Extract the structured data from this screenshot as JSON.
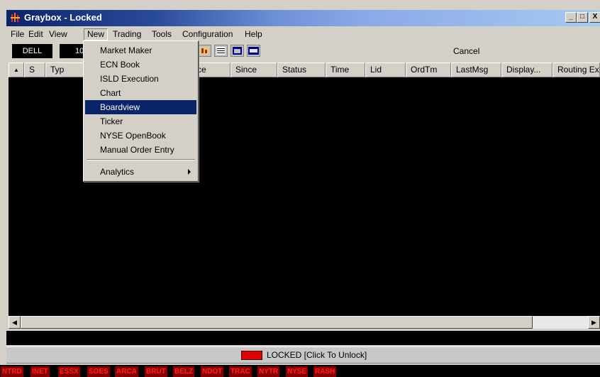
{
  "window": {
    "title": "Graybox - Locked",
    "min_label": "_",
    "max_label": "□",
    "close_label": "X"
  },
  "menubar": [
    "File",
    "Edit",
    "View",
    "New",
    "Trading",
    "Tools",
    "Configuration",
    "Help"
  ],
  "toolbar": {
    "symbol": "DELL",
    "quantity": "10",
    "cancel_label": "Cancel"
  },
  "columns": [
    "",
    "S",
    "Typ",
    "ce",
    "Since",
    "Status",
    "Time",
    "Lid",
    "OrdTm",
    "LastMsg",
    "Display...",
    "Routing Ex"
  ],
  "new_menu": {
    "items": [
      "Market Maker",
      "ECN Book",
      "ISLD Execution",
      "Chart",
      "Boardview",
      "Ticker",
      "NYSE OpenBook",
      "Manual Order Entry"
    ],
    "selected": "Boardview",
    "submenu_item": "Analytics"
  },
  "lock": {
    "text": "LOCKED [Click To Unlock]",
    "color": "#e00000"
  },
  "ecn_tags": [
    "NTRD",
    "INET",
    "ESSX",
    "SOES",
    "ARCA",
    "BRUT",
    "BELZ",
    "NDOT",
    "TRAC",
    "NYTR",
    "NYSE",
    "RASH"
  ]
}
